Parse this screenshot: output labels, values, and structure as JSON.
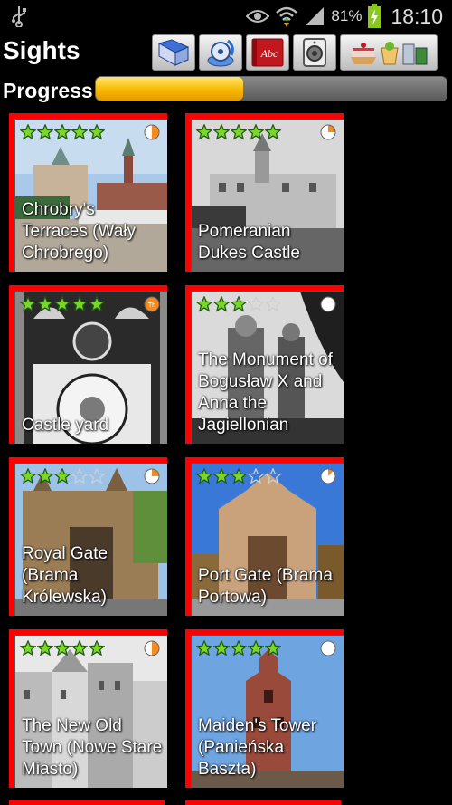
{
  "status": {
    "battery_pct": "81%",
    "time": "18:10",
    "icons": [
      "usb-icon",
      "eye-icon",
      "wifi-icon",
      "signal-icon",
      "battery-charging-icon"
    ]
  },
  "header": {
    "title": "Sights",
    "toolbar": [
      {
        "name": "map-button",
        "icon": "map-icon"
      },
      {
        "name": "compass-button",
        "icon": "compass-icon"
      },
      {
        "name": "dictionary-button",
        "icon": "dictionary-icon",
        "text": "Abc"
      },
      {
        "name": "speaker-button",
        "icon": "speaker-icon"
      },
      {
        "name": "food-drinks-button",
        "icon": "food-drinks-icon"
      }
    ]
  },
  "progress": {
    "label": "Progress",
    "value_fraction": 0.42
  },
  "colors": {
    "accent_red": "#ff0000",
    "progress_orange": "#f7b800",
    "star_green": "#7cd629",
    "timer_orange": "#f58a1f"
  },
  "sights": [
    {
      "name": "Chrobry's Terraces (Wały Chrobrego)",
      "rating": 5,
      "timer_fraction": 0.5,
      "timer_badge": "",
      "photo": "harbor-buildings"
    },
    {
      "name": "Pomeranian Dukes Castle",
      "rating": 5,
      "timer_fraction": 0.25,
      "timer_badge": "",
      "photo": "castle-bw"
    },
    {
      "name": "Castle yard",
      "rating": 5,
      "timer_fraction": 1.0,
      "timer_badge": "Th",
      "photo": "clock-bw"
    },
    {
      "name": "The Monument of Bogusław X and Anna the Jagiellonian",
      "rating": 3,
      "timer_fraction": 0.0,
      "timer_badge": "",
      "photo": "monument-bw"
    },
    {
      "name": "Royal Gate (Brama Królewska)",
      "rating": 3,
      "timer_fraction": 0.25,
      "timer_badge": "",
      "photo": "royal-gate"
    },
    {
      "name": "Port Gate (Brama Portowa)",
      "rating": 3,
      "timer_fraction": 0.12,
      "timer_badge": "",
      "photo": "port-gate"
    },
    {
      "name": "The New Old Town (Nowe Stare Miasto)",
      "rating": 5,
      "timer_fraction": 0.5,
      "timer_badge": "",
      "photo": "old-town-bw"
    },
    {
      "name": "Maiden's Tower (Panieńska Baszta)",
      "rating": 5,
      "timer_fraction": 0.0,
      "timer_badge": "",
      "photo": "maidens-tower"
    }
  ]
}
